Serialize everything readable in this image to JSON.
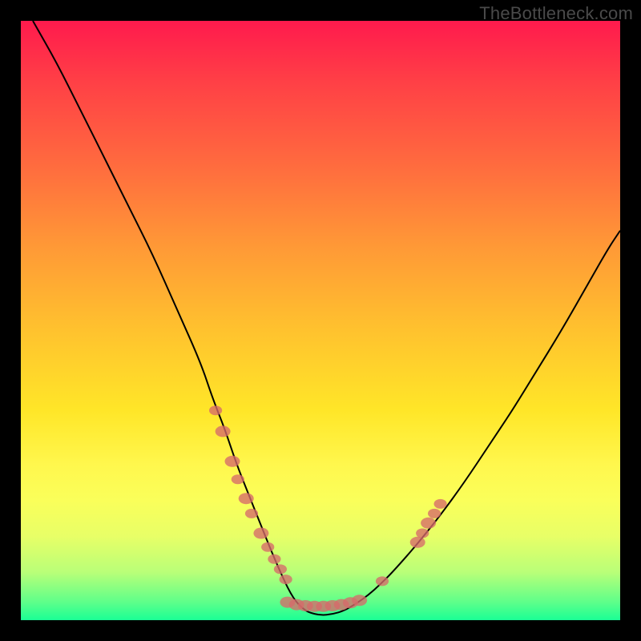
{
  "watermark": "TheBottleneck.com",
  "colors": {
    "background": "#000000",
    "curve": "#000000",
    "dots": "#d66a6a",
    "gradient_top": "#ff1a4d",
    "gradient_bottom": "#1aff95"
  },
  "chart_data": {
    "type": "line",
    "title": "",
    "xlabel": "",
    "ylabel": "",
    "xlim": [
      0,
      100
    ],
    "ylim": [
      0,
      100
    ],
    "grid": false,
    "legend": false,
    "series": [
      {
        "name": "curve",
        "x": [
          2,
          6,
          10,
          14,
          18,
          22,
          26,
          30,
          32,
          34,
          36,
          38,
          40,
          42,
          44,
          45,
          46,
          47,
          48,
          50,
          52,
          54,
          56,
          58,
          60,
          62,
          66,
          70,
          74,
          78,
          82,
          86,
          90,
          94,
          98,
          100
        ],
        "y": [
          100,
          93,
          85,
          77,
          69,
          61,
          52,
          43,
          37,
          32,
          26,
          21,
          16,
          11,
          6.5,
          4.5,
          3,
          2,
          1.3,
          0.8,
          1.0,
          1.6,
          2.8,
          4.2,
          6,
          8,
          12.5,
          17.5,
          23,
          29,
          35,
          41.5,
          48,
          55,
          62,
          65
        ]
      }
    ],
    "scatter_points": [
      {
        "x": 32.5,
        "y": 35,
        "r": 6
      },
      {
        "x": 33.7,
        "y": 31.5,
        "r": 7
      },
      {
        "x": 35.3,
        "y": 26.5,
        "r": 7
      },
      {
        "x": 36.2,
        "y": 23.5,
        "r": 6
      },
      {
        "x": 37.6,
        "y": 20.3,
        "r": 7
      },
      {
        "x": 38.5,
        "y": 17.8,
        "r": 6
      },
      {
        "x": 40.1,
        "y": 14.5,
        "r": 7
      },
      {
        "x": 41.2,
        "y": 12.2,
        "r": 6
      },
      {
        "x": 42.3,
        "y": 10.2,
        "r": 6
      },
      {
        "x": 43.3,
        "y": 8.5,
        "r": 6
      },
      {
        "x": 44.2,
        "y": 6.8,
        "r": 6
      },
      {
        "x": 44.5,
        "y": 3.0,
        "r": 7
      },
      {
        "x": 46.0,
        "y": 2.6,
        "r": 7
      },
      {
        "x": 47.5,
        "y": 2.4,
        "r": 7
      },
      {
        "x": 49.0,
        "y": 2.3,
        "r": 7
      },
      {
        "x": 50.5,
        "y": 2.3,
        "r": 7
      },
      {
        "x": 52.0,
        "y": 2.4,
        "r": 7
      },
      {
        "x": 53.5,
        "y": 2.6,
        "r": 7
      },
      {
        "x": 55.0,
        "y": 2.9,
        "r": 7
      },
      {
        "x": 56.5,
        "y": 3.3,
        "r": 7
      },
      {
        "x": 60.3,
        "y": 6.5,
        "r": 6
      },
      {
        "x": 66.2,
        "y": 13.0,
        "r": 7
      },
      {
        "x": 67.0,
        "y": 14.5,
        "r": 6
      },
      {
        "x": 68.0,
        "y": 16.2,
        "r": 7
      },
      {
        "x": 69.0,
        "y": 17.8,
        "r": 6
      },
      {
        "x": 70.0,
        "y": 19.4,
        "r": 6
      }
    ]
  }
}
